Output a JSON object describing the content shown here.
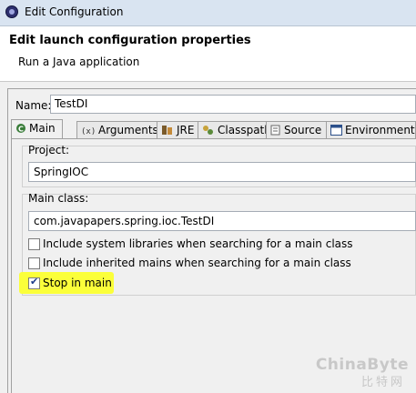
{
  "window": {
    "title": "Edit Configuration"
  },
  "header": {
    "heading": "Edit launch configuration properties",
    "subtitle": "Run a Java application"
  },
  "config": {
    "name_label": "Name:",
    "name_value": "TestDI"
  },
  "tabs": [
    {
      "label": "Main",
      "icon": "main-tab-icon",
      "active": true
    },
    {
      "label": "Arguments",
      "icon": "arguments-icon",
      "active": false
    },
    {
      "label": "JRE",
      "icon": "jre-icon",
      "active": false
    },
    {
      "label": "Classpath",
      "icon": "classpath-icon",
      "active": false
    },
    {
      "label": "Source",
      "icon": "source-icon",
      "active": false
    },
    {
      "label": "Environment",
      "icon": "environment-icon",
      "active": false
    }
  ],
  "main": {
    "project_label": "Project:",
    "project_value": "SpringIOC",
    "main_class_label": "Main class:",
    "main_class_value": "com.javapapers.spring.ioc.TestDI",
    "options": [
      {
        "label": "Include system libraries when searching for a main class",
        "checked": false
      },
      {
        "label": "Include inherited mains when searching for a main class",
        "checked": false
      },
      {
        "label": "Stop in main",
        "checked": true
      }
    ]
  },
  "watermark": {
    "line1": "ChinaByte",
    "line2": "比特网"
  },
  "colors": {
    "highlight": "#fbff3a",
    "titlebar": "#d9e4f1"
  }
}
